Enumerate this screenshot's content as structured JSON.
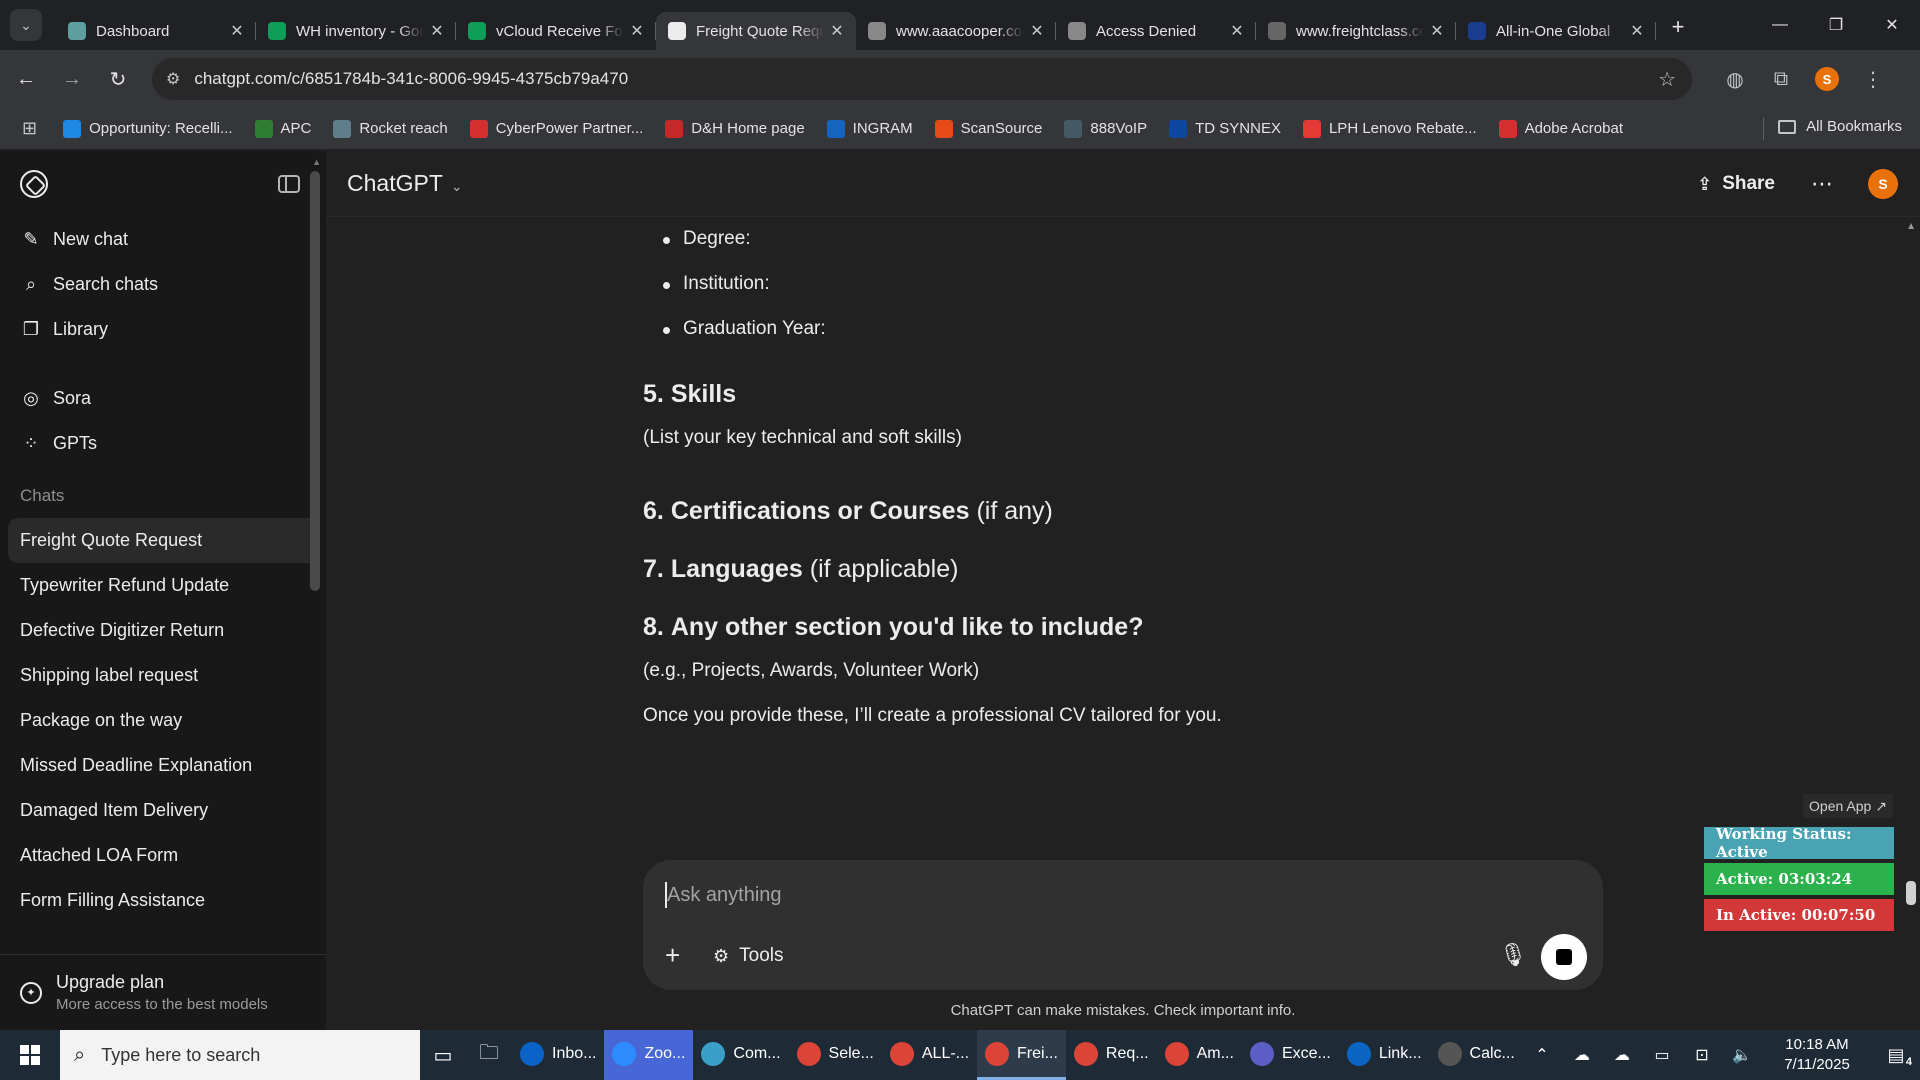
{
  "browser": {
    "tabs": [
      {
        "title": "Dashboard",
        "icon": "dashboard-favicon",
        "color": "#5f9ea0"
      },
      {
        "title": "WH inventory - Google Sheets",
        "icon": "sheets-favicon",
        "color": "#0f9d58"
      },
      {
        "title": "vCloud Receive Form",
        "icon": "sheets-favicon",
        "color": "#0f9d58"
      },
      {
        "title": "Freight Quote Request",
        "icon": "chatgpt-favicon",
        "color": "#ececec",
        "active": true
      },
      {
        "title": "www.aaacooper.com",
        "icon": "aaacooper-favicon",
        "color": "#888888"
      },
      {
        "title": "Access Denied",
        "icon": "globe-favicon",
        "color": "#888888"
      },
      {
        "title": "www.freightclass.com",
        "icon": "freightclass-favicon",
        "color": "#666666"
      },
      {
        "title": "All-in-One Global",
        "icon": "all-in-one-favicon",
        "color": "#1a3d8f"
      }
    ],
    "url": "chatgpt.com/c/6851784b-341c-8006-9945-4375cb79a470",
    "bookmarks": [
      {
        "label": "Opportunity: Recelli...",
        "icon": "cloud-favicon",
        "color": "#1e88e5"
      },
      {
        "label": "APC",
        "icon": "apc-favicon",
        "color": "#2e7d32"
      },
      {
        "label": "Rocket reach",
        "icon": "rocket-favicon",
        "color": "#607d8b"
      },
      {
        "label": "CyberPower Partner...",
        "icon": "cyberpower-favicon",
        "color": "#d32f2f"
      },
      {
        "label": "D&H Home page",
        "icon": "dh-favicon",
        "color": "#c62828"
      },
      {
        "label": "INGRAM",
        "icon": "ingram-favicon",
        "color": "#1565c0"
      },
      {
        "label": "ScanSource",
        "icon": "scansource-favicon",
        "color": "#e64a19"
      },
      {
        "label": "888VoIP",
        "icon": "voip-favicon",
        "color": "#455a64"
      },
      {
        "label": "TD SYNNEX",
        "icon": "tdsynnex-favicon",
        "color": "#0d47a1"
      },
      {
        "label": "LPH Lenovo Rebate...",
        "icon": "lenovo-favicon",
        "color": "#e53935"
      },
      {
        "label": "Adobe Acrobat",
        "icon": "acrobat-favicon",
        "color": "#d32f2f"
      }
    ],
    "all_bookmarks": "All Bookmarks"
  },
  "sidebar": {
    "actions": [
      {
        "label": "New chat",
        "icon": "new-chat-icon",
        "glyph": "✎"
      },
      {
        "label": "Search chats",
        "icon": "search-icon",
        "glyph": "⌕"
      },
      {
        "label": "Library",
        "icon": "library-icon",
        "glyph": "❐"
      }
    ],
    "apps": [
      {
        "label": "Sora",
        "icon": "sora-icon",
        "glyph": "◎"
      },
      {
        "label": "GPTs",
        "icon": "gpts-icon",
        "glyph": "⁘"
      }
    ],
    "chats_heading": "Chats",
    "chats": [
      "Freight Quote Request",
      "Typewriter Refund Update",
      "Defective Digitizer Return",
      "Shipping label request",
      "Package on the way",
      "Missed Deadline Explanation",
      "Damaged Item Delivery",
      "Attached LOA Form",
      "Form Filling Assistance"
    ],
    "upgrade": {
      "title": "Upgrade plan",
      "subtitle": "More access to the best models"
    }
  },
  "header": {
    "model": "ChatGPT",
    "share": "Share",
    "avatar": "S"
  },
  "message": {
    "bullets": [
      "Degree:",
      "Institution:",
      "Graduation Year:"
    ],
    "s5": {
      "num": "5.",
      "title": "Skills"
    },
    "s5_text": "(List your key technical and soft skills)",
    "s6": {
      "num": "6.",
      "title": "Certifications or Courses",
      "suffix": " (if any)"
    },
    "s7": {
      "num": "7.",
      "title": "Languages",
      "suffix": " (if applicable)"
    },
    "s8": {
      "num": "8.",
      "title": "Any other section you'd like to include?"
    },
    "s8_text": "(e.g., Projects, Awards, Volunteer Work)",
    "closing": "Once you provide these, I’ll create a professional CV tailored for you."
  },
  "composer": {
    "placeholder": "Ask anything",
    "tools": "Tools",
    "disclaimer": "ChatGPT can make mistakes. Check important info."
  },
  "widget": {
    "open_app": "Open App ↗",
    "working": "Working Status: Active",
    "active": "Active: 03:03:24",
    "inactive": "In Active: 00:07:50"
  },
  "taskbar": {
    "search_placeholder": "Type here to search",
    "apps": [
      {
        "label": "Inbo...",
        "icon": "outlook-icon",
        "color": "#0a64c8"
      },
      {
        "label": "Zoo...",
        "icon": "zoom-icon",
        "color": "#2d8cff",
        "zoom": true
      },
      {
        "label": "Com...",
        "icon": "company-app-icon",
        "color": "#3aa0c8"
      },
      {
        "label": "Sele...",
        "icon": "chrome-icon",
        "color": "#db4437"
      },
      {
        "label": "ALL-...",
        "icon": "chrome-icon",
        "color": "#db4437"
      },
      {
        "label": "Frei...",
        "icon": "chrome-icon",
        "color": "#db4437",
        "active": true
      },
      {
        "label": "Req...",
        "icon": "chrome-icon",
        "color": "#db4437"
      },
      {
        "label": "Am...",
        "icon": "chrome-icon",
        "color": "#db4437"
      },
      {
        "label": "Exce...",
        "icon": "teams-icon",
        "color": "#5b5fc7"
      },
      {
        "label": "Link...",
        "icon": "linkedin-icon",
        "color": "#0a66c2"
      },
      {
        "label": "Calc...",
        "icon": "calculator-icon",
        "color": "#555555"
      }
    ],
    "time": "10:18 AM",
    "date": "7/11/2025",
    "notifications": "4"
  }
}
